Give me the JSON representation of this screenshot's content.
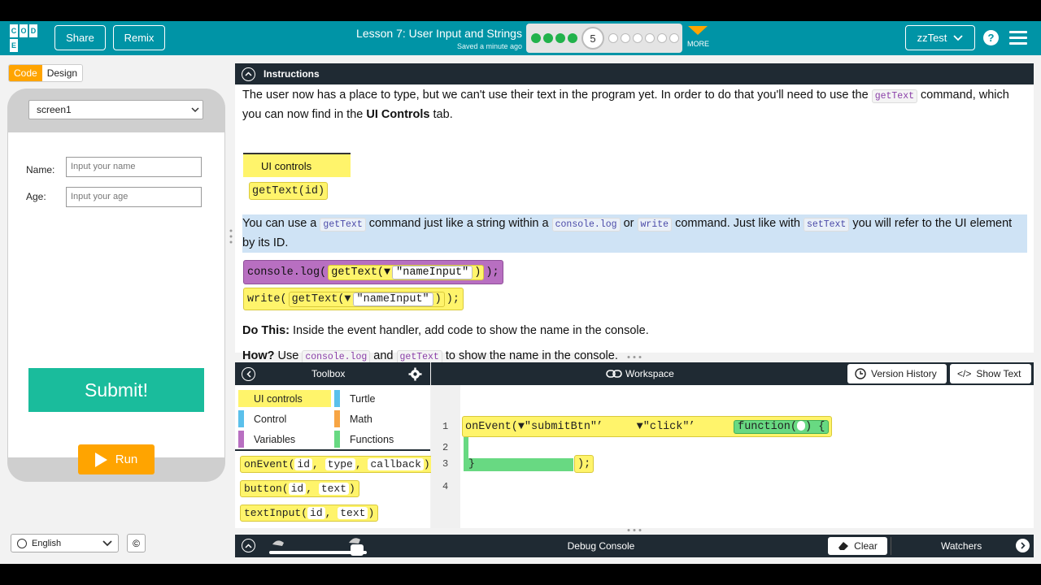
{
  "header": {
    "logo_letters": [
      "C",
      "O",
      "D",
      "E"
    ],
    "share_label": "Share",
    "remix_label": "Remix",
    "lesson_title": "Lesson 7: User Input and Strings",
    "saved_status": "Saved a minute ago",
    "current_level": "5",
    "levels_completed": 4,
    "levels_remaining": 6,
    "more_label": "MORE",
    "user_name": "zzTest",
    "help_label": "?"
  },
  "left": {
    "tab_code": "Code",
    "tab_design": "Design",
    "screen_select": "screen1",
    "name_label": "Name:",
    "name_placeholder": "Input your name",
    "age_label": "Age:",
    "age_placeholder": "Input your age",
    "submit_label": "Submit!",
    "run_label": "Run",
    "language": "English",
    "copyright": "©"
  },
  "instructions": {
    "header": "Instructions",
    "p1_a": "The user now has a place to type, but we can't use their text in the program yet. In order to do that you'll need to use the",
    "p1_code": "getText",
    "p1_b": "command, which you can now find in the",
    "p1_bold": "UI Controls",
    "p1_c": "tab.",
    "ui_controls_label": "UI controls",
    "gettext_block": "getText(id)",
    "p2_a": "You can use a",
    "p2_code1": "getText",
    "p2_b": "command just like a string within a",
    "p2_code2": "console.log",
    "p2_c": "or",
    "p2_code3": "write",
    "p2_d": "command. Just like with",
    "p2_code4": "setText",
    "p2_e": "you will refer to the UI element by its ID.",
    "ex1_prefix": "console.log(",
    "ex1_inner": "getText(",
    "ex1_str": "\"nameInput\"",
    "ex1_suffix": ");",
    "ex2_prefix": "write(",
    "ex2_inner": "getText(",
    "ex2_str": "\"nameInput\"",
    "ex2_suffix": ");",
    "do_this_bold": "Do This:",
    "do_this_text": "Inside the event handler, add code to show the name in the console.",
    "how_bold": "How?",
    "how_a": "Use",
    "how_code1": "console.log",
    "how_b": "and",
    "how_code2": "getText",
    "how_c": "to show the name in the console."
  },
  "toolbox": {
    "title": "Toolbox",
    "categories": [
      {
        "label": "UI controls",
        "color": "#fff46b"
      },
      {
        "label": "Turtle",
        "color": "#5bc0eb"
      },
      {
        "label": "Control",
        "color": "#5bc0eb"
      },
      {
        "label": "Math",
        "color": "#f7a544"
      },
      {
        "label": "Variables",
        "color": "#b86fc1"
      },
      {
        "label": "Functions",
        "color": "#68d982"
      }
    ],
    "blocks": [
      {
        "name": "onEvent(",
        "args": [
          "id",
          "type",
          "callback"
        ]
      },
      {
        "name": "button(",
        "args": [
          "id",
          "text"
        ]
      },
      {
        "name": "textInput(",
        "args": [
          "id",
          "text"
        ]
      }
    ]
  },
  "workspace": {
    "title": "Workspace",
    "version_history_label": "Version History",
    "show_text_label": "Show Text",
    "line_numbers": [
      "1",
      "2",
      "3",
      "4"
    ],
    "on_event": "onEvent(",
    "arg1": "\"submitBtn\"",
    "arg2": "\"click\"",
    "func": "function(",
    "close_brace": "}",
    "close_paren": ");"
  },
  "debug": {
    "title": "Debug Console",
    "clear_label": "Clear",
    "watchers_label": "Watchers"
  },
  "colors": {
    "header": "#0094a6",
    "accent": "#ffa400",
    "ui_controls": "#fff46b",
    "console_block": "#b86fc1",
    "function_block": "#68d982",
    "submit": "#1abc9c"
  }
}
